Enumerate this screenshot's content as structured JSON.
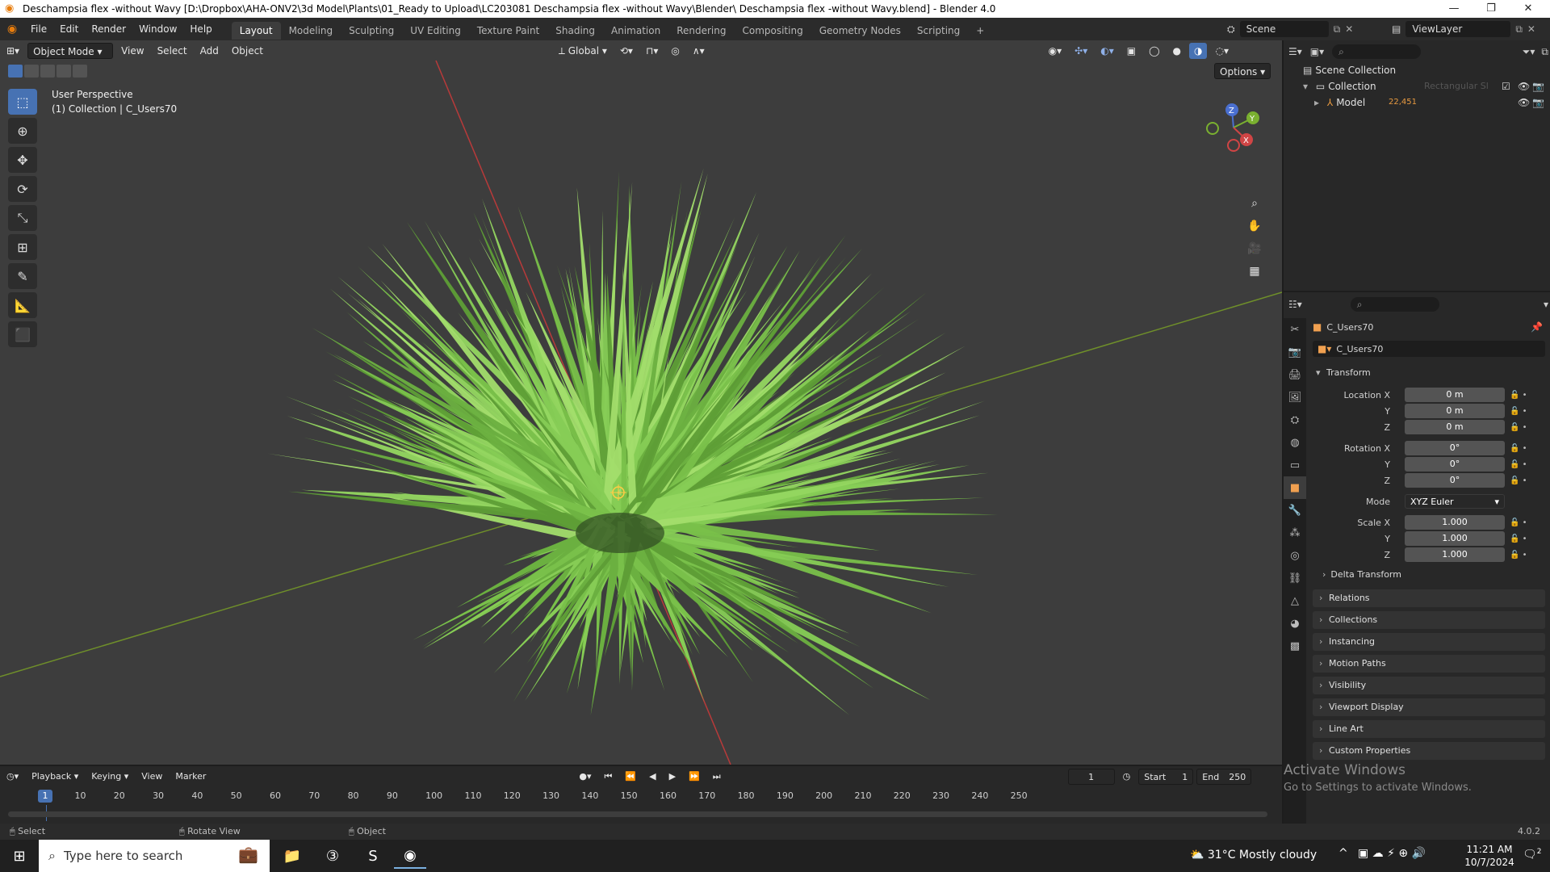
{
  "window": {
    "title": "Deschampsia flex -without Wavy [D:\\Dropbox\\AHA-ONV2\\3d Model\\Plants\\01_Ready to Upload\\LC203081 Deschampsia flex -without Wavy\\Blender\\ Deschampsia flex -without Wavy.blend] - Blender 4.0"
  },
  "menu": [
    "File",
    "Edit",
    "Render",
    "Window",
    "Help"
  ],
  "workspaces": [
    "Layout",
    "Modeling",
    "Sculpting",
    "UV Editing",
    "Texture Paint",
    "Shading",
    "Animation",
    "Rendering",
    "Compositing",
    "Geometry Nodes",
    "Scripting"
  ],
  "active_workspace": "Layout",
  "topright": {
    "scene": "Scene",
    "view_layer": "ViewLayer"
  },
  "viewport": {
    "mode": "Object Mode",
    "menus": [
      "View",
      "Select",
      "Add",
      "Object"
    ],
    "orientation": "Global",
    "options": "Options",
    "info_line1": "User Perspective",
    "info_line2": "(1) Collection | C_Users70",
    "gizmo": {
      "x": "X",
      "y": "Y",
      "z": "Z"
    }
  },
  "outliner": {
    "root": "Scene Collection",
    "collection": "Collection",
    "model": "Model",
    "ghost": "Rectangular Sl",
    "badge": "22,451"
  },
  "properties": {
    "object_name": "C_Users70",
    "data_name": "C_Users70",
    "transform_title": "Transform",
    "location": {
      "label": "Location X",
      "x": "0 m",
      "y": "0 m",
      "z": "0 m"
    },
    "rotation": {
      "label": "Rotation X",
      "x": "0°",
      "y": "0°",
      "z": "0°"
    },
    "mode_label": "Mode",
    "mode_value": "XYZ Euler",
    "scale": {
      "label": "Scale X",
      "x": "1.000",
      "y": "1.000",
      "z": "1.000"
    },
    "axis_labels": {
      "y": "Y",
      "z": "Z"
    },
    "delta": "Delta Transform",
    "panels": [
      "Relations",
      "Collections",
      "Instancing",
      "Motion Paths",
      "Visibility",
      "Viewport Display",
      "Line Art",
      "Custom Properties"
    ]
  },
  "activate_windows": {
    "line1": "Activate Windows",
    "line2": "Go to Settings to activate Windows."
  },
  "timeline": {
    "menus": [
      "Playback",
      "Keying",
      "View",
      "Marker"
    ],
    "current_frame": "1",
    "start_label": "Start",
    "start": "1",
    "end_label": "End",
    "end": "250",
    "ticks": [
      "10",
      "20",
      "30",
      "40",
      "50",
      "60",
      "70",
      "80",
      "90",
      "100",
      "110",
      "120",
      "130",
      "140",
      "150",
      "160",
      "170",
      "180",
      "190",
      "200",
      "210",
      "220",
      "230",
      "240",
      "250"
    ]
  },
  "statusbar": {
    "select": "Select",
    "rotate": "Rotate View",
    "object": "Object",
    "version": "4.0.2"
  },
  "taskbar": {
    "search_placeholder": "Type here to search",
    "weather": "31°C  Mostly cloudy",
    "time": "11:21 AM",
    "date": "10/7/2024",
    "notif_count": "2"
  },
  "colors": {
    "accent": "#4772b3",
    "grass": "#8ccf5a",
    "axis_x": "#c04040",
    "axis_y": "#7a9a30"
  }
}
